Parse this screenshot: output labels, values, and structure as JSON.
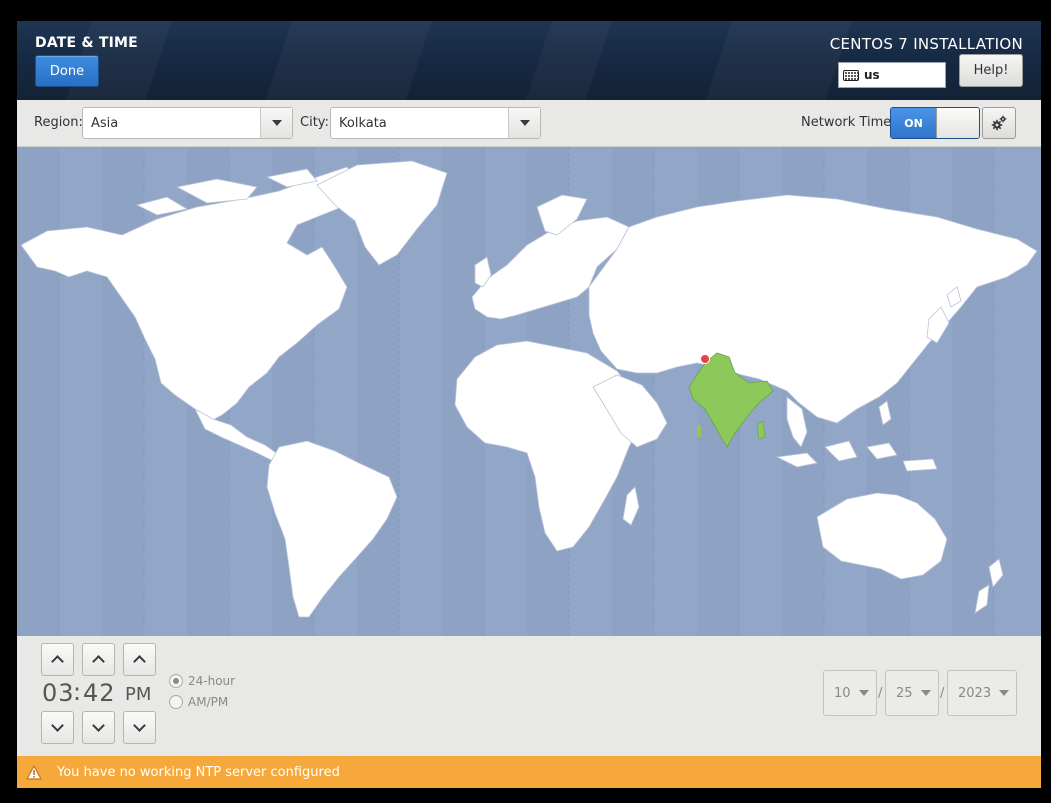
{
  "header": {
    "screen_title": "DATE & TIME",
    "done_label": "Done",
    "product_title": "CENTOS 7 INSTALLATION",
    "keyboard_layout": "us",
    "help_label": "Help!"
  },
  "toolbar": {
    "region_label": "Region:",
    "region_value": "Asia",
    "city_label": "City:",
    "city_value": "Kolkata",
    "network_time_label": "Network Time",
    "network_time_state": "ON",
    "settings_icon": "gear-icon"
  },
  "map": {
    "selected_country": "India",
    "selected_city": "Kolkata",
    "ocean_color": "#92a6c8",
    "land_color": "#ffffff",
    "highlight_color": "#8cc85a",
    "pin_color": "#e8404a"
  },
  "time": {
    "hours": "03",
    "separator": ":",
    "minutes": "42",
    "ampm": "PM",
    "format_24h_label": "24-hour",
    "format_ampm_label": "AM/PM",
    "selected_format": "24-hour"
  },
  "date": {
    "month": "10",
    "day": "25",
    "year": "2023",
    "separator": "/"
  },
  "warning": {
    "icon": "warning-icon",
    "message": "You have no working NTP server configured",
    "color": "#f6a93a"
  }
}
